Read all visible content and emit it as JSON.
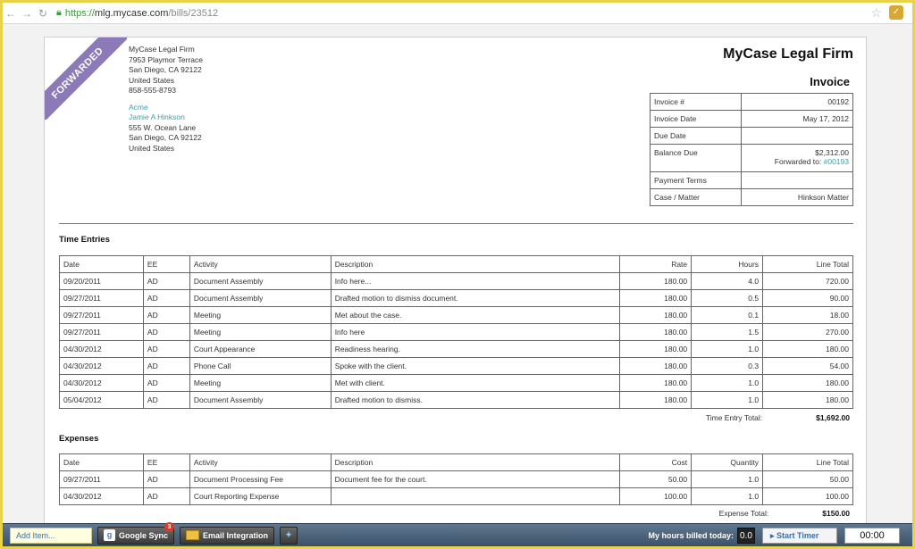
{
  "browser": {
    "url_scheme": "https://",
    "url_host": "mlg.mycase.com",
    "url_path": "/bills/23512"
  },
  "ribbon": "FORWARDED",
  "firm": {
    "name": "MyCase Legal Firm",
    "address_lines": [
      "7953 Playmor Terrace",
      "San Diego, CA 92122",
      "United States",
      "858-555-8793"
    ]
  },
  "client": {
    "company": "Acme",
    "contact": "Jamie A Hinkson",
    "address_lines": [
      "555 W. Ocean Lane",
      "San Diego, CA 92122",
      "United States"
    ]
  },
  "invoice_title": "Invoice",
  "meta": {
    "invoice_no_label": "Invoice #",
    "invoice_no": "00192",
    "invoice_date_label": "Invoice Date",
    "invoice_date": "May 17, 2012",
    "due_date_label": "Due Date",
    "due_date": "",
    "balance_label": "Balance Due",
    "balance": "$2,312.00",
    "forwarded_prefix": "Forwarded to:",
    "forwarded_link": "#00193",
    "terms_label": "Payment Terms",
    "terms": "",
    "matter_label": "Case / Matter",
    "matter": "Hinkson Matter"
  },
  "time_entries": {
    "heading": "Time Entries",
    "columns": [
      "Date",
      "EE",
      "Activity",
      "Description",
      "Rate",
      "Hours",
      "Line Total"
    ],
    "rows": [
      [
        "09/20/2011",
        "AD",
        "Document Assembly",
        "Info here...",
        "180.00",
        "4.0",
        "720.00"
      ],
      [
        "09/27/2011",
        "AD",
        "Document Assembly",
        "Drafted motion to dismiss document.",
        "180.00",
        "0.5",
        "90.00"
      ],
      [
        "09/27/2011",
        "AD",
        "Meeting",
        "Met about the case.",
        "180.00",
        "0.1",
        "18.00"
      ],
      [
        "09/27/2011",
        "AD",
        "Meeting",
        "Info here",
        "180.00",
        "1.5",
        "270.00"
      ],
      [
        "04/30/2012",
        "AD",
        "Court Appearance",
        "Readiness hearing.",
        "180.00",
        "1.0",
        "180.00"
      ],
      [
        "04/30/2012",
        "AD",
        "Phone Call",
        "Spoke with the client.",
        "180.00",
        "0.3",
        "54.00"
      ],
      [
        "04/30/2012",
        "AD",
        "Meeting",
        "Met with client.",
        "180.00",
        "1.0",
        "180.00"
      ],
      [
        "05/04/2012",
        "AD",
        "Document Assembly",
        "Drafted motion to dismiss.",
        "180.00",
        "1.0",
        "180.00"
      ]
    ],
    "total_label": "Time Entry Total:",
    "total": "$1,692.00"
  },
  "expenses": {
    "heading": "Expenses",
    "columns": [
      "Date",
      "EE",
      "Activity",
      "Description",
      "Cost",
      "Quantity",
      "Line Total"
    ],
    "rows": [
      [
        "09/27/2011",
        "AD",
        "Document Processing Fee",
        "Document fee for the court.",
        "50.00",
        "1.0",
        "50.00"
      ],
      [
        "04/30/2012",
        "AD",
        "Court Reporting Expense",
        "",
        "100.00",
        "1.0",
        "100.00"
      ]
    ],
    "total_label": "Expense Total:",
    "total": "$150.00"
  },
  "taskbar": {
    "add_item": "Add Item...",
    "google_sync": "Google Sync",
    "google_badge": "3",
    "email_integration": "Email Integration",
    "hours_label": "My hours billed today:",
    "hours_value": "0.0",
    "start_timer": "▸ Start Timer",
    "timer": "00:00"
  },
  "colors": {
    "ribbon": "#8b79b8",
    "link": "#3ea0a8",
    "taskbar": "#4a6278",
    "frame": "#e8d44a"
  }
}
